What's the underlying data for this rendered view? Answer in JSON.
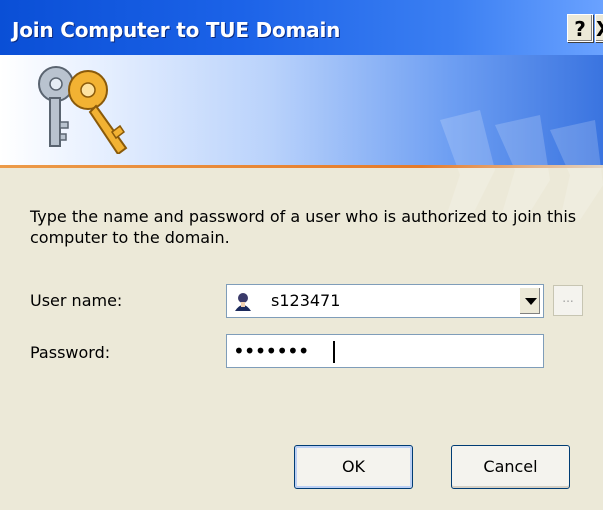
{
  "window": {
    "title": "Join Computer to TUE Domain",
    "help_label": "?",
    "close_label": "X"
  },
  "content": {
    "description": "Type the name and password of a user who is authorized to join this computer to the domain."
  },
  "fields": {
    "user_label": "User name:",
    "user_value": "s123471",
    "password_label": "Password:",
    "password_mask": "•••••••"
  },
  "buttons": {
    "browse_label": "...",
    "ok_label": "OK",
    "cancel_label": "Cancel"
  },
  "icons": {
    "banner": "keys-icon",
    "user": "user-icon",
    "dropdown": "chevron-down-icon"
  },
  "colors": {
    "titlebar": "#0a4fd6",
    "dialog_bg": "#ece9d8",
    "banner_accent": "#e67b2a",
    "button_border": "#003c74"
  }
}
